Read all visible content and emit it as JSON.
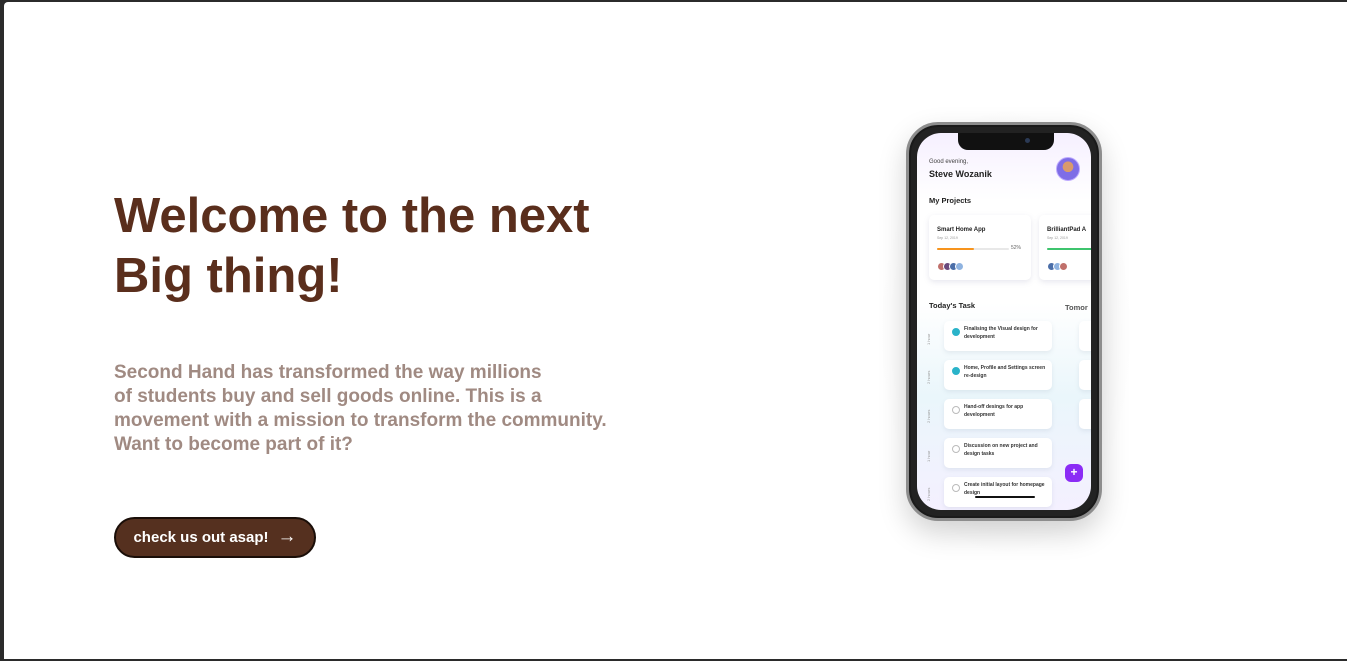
{
  "hero": {
    "title_line1": "Welcome to the next",
    "title_line2": "Big thing!",
    "text_lines": [
      "Second Hand has transformed the way millions",
      "of students buy and sell goods online. This is a",
      "movement with a mission to transform the community.",
      "Want to become part of it?"
    ],
    "cta_label": "check us out asap!",
    "cta_icon": "arrow-right-icon"
  },
  "colors": {
    "title": "#5a2e1c",
    "body_text": "#a08a82",
    "cta_bg": "#55301f",
    "accent_purple": "#8b2cf5",
    "check_teal": "#2ab3c9"
  },
  "phone": {
    "greeting": "Good evening,",
    "user_name": "Steve Wozanik",
    "projects_title": "My Projects",
    "projects": [
      {
        "name": "Smart Home App",
        "date": "Sep 12, 2019",
        "percent": "52%",
        "progress": 0.52,
        "color": "#f7941d"
      },
      {
        "name": "BrilliantPad A",
        "date": "Sep 12, 2019",
        "percent": "",
        "progress": 0.7,
        "color": "#3ec46d"
      }
    ],
    "today_title": "Today's Task",
    "tomorrow_title": "Tomor",
    "tasks": [
      {
        "hours": "1 hour",
        "text": "Finalising the Visual design for development",
        "done": true
      },
      {
        "hours": "2 hours",
        "text": "Home, Profile and Settings screen re-design",
        "done": true
      },
      {
        "hours": "2 hours",
        "text": "Hand-off desings for app development",
        "done": false
      },
      {
        "hours": "1 hour",
        "text": "Discussion on new project and design tasks",
        "done": false
      },
      {
        "hours": "2 hours",
        "text": "Create initial layout for homepage design",
        "done": false
      }
    ],
    "fab_label": "+"
  }
}
